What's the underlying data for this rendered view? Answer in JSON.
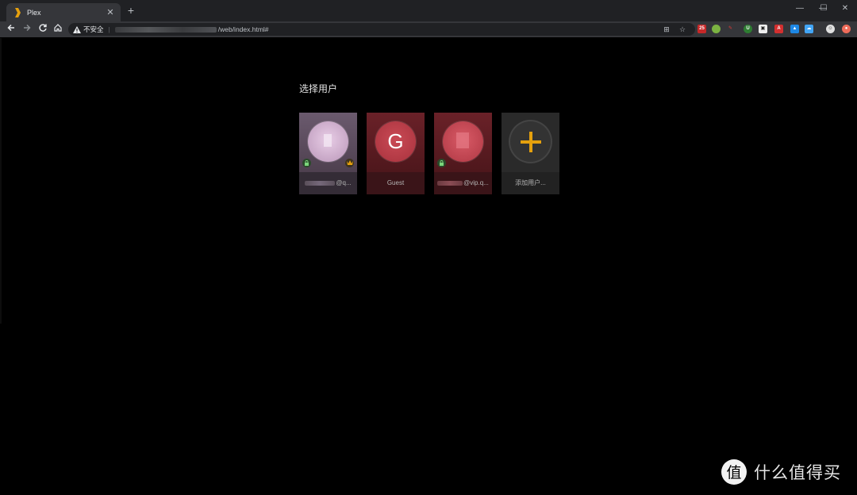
{
  "browser": {
    "tab_title": "Plex",
    "new_tab_symbol": "+",
    "address": {
      "security_label": "不安全",
      "path": "/web/index.html#"
    },
    "window_controls": {
      "minimize": "—",
      "maximize": "☐",
      "close": "✕"
    }
  },
  "page": {
    "heading": "选择用户",
    "users": [
      {
        "label_suffix": "@q...",
        "locked": true,
        "admin": true,
        "style": "avatar"
      },
      {
        "label": "Guest",
        "initial": "G",
        "style": "guest"
      },
      {
        "label_suffix": "@vip.q...",
        "locked": true,
        "style": "avatar"
      },
      {
        "label": "添加用户...",
        "style": "add"
      }
    ]
  },
  "watermark": {
    "text": "什么值得买",
    "logo_text": "值"
  },
  "colors": {
    "plex_accent": "#e5a00d",
    "card_purple": "#5a4a5c",
    "card_red": "#5d1f25",
    "card_dark": "#2a2a2a"
  }
}
